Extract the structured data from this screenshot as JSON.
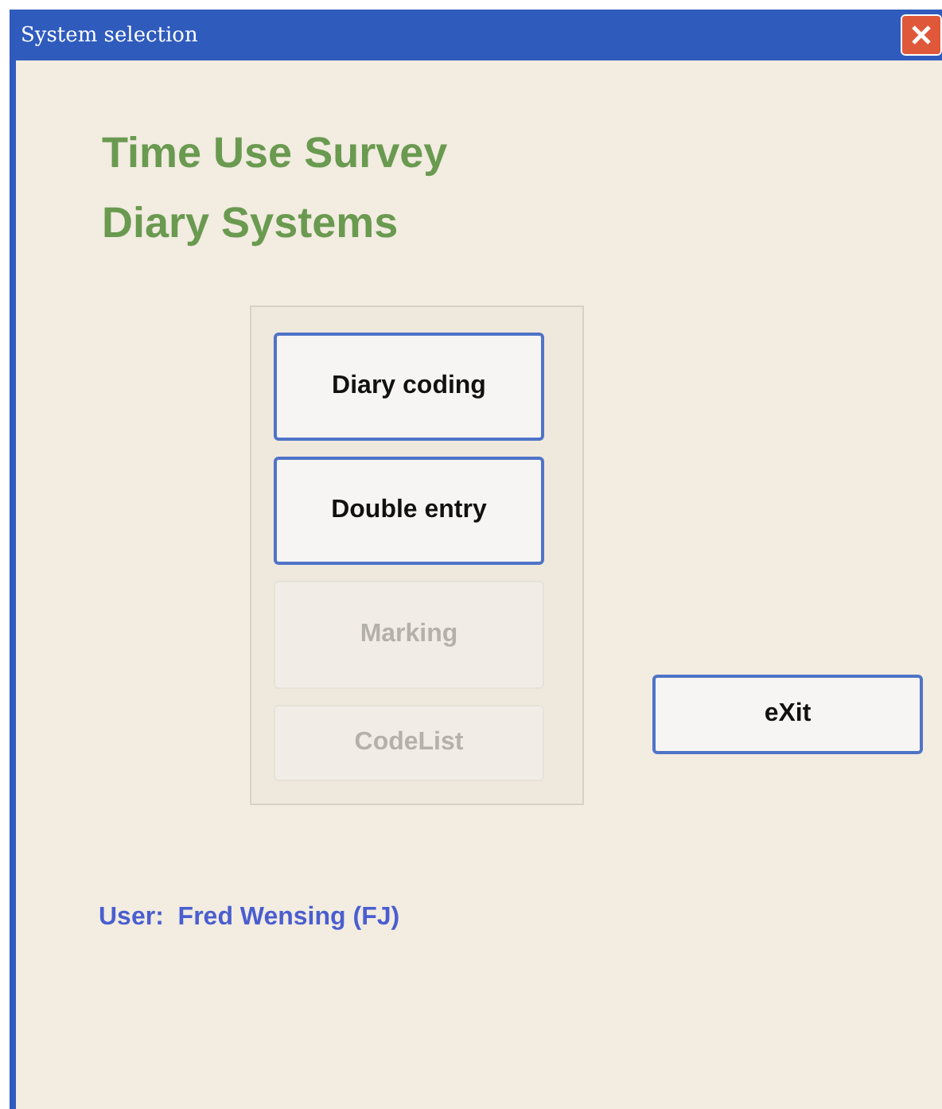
{
  "window": {
    "title": "System selection"
  },
  "heading": [
    "Time Use Survey",
    "Diary Systems"
  ],
  "menu_buttons": [
    {
      "label": "Diary coding",
      "disabled": false
    },
    {
      "label": "Double entry",
      "disabled": false
    },
    {
      "label": "Marking",
      "disabled": true
    },
    {
      "label": "CodeList",
      "disabled": true
    }
  ],
  "exit_button": {
    "label": "eXit"
  },
  "user_label": "User:  Fred Wensing (FJ)"
}
